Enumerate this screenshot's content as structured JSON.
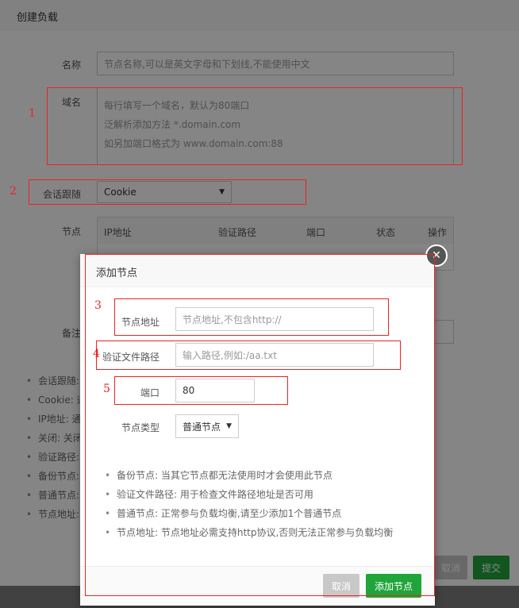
{
  "outer": {
    "title": "创建负载",
    "name_label": "名称",
    "name_placeholder": "节点名称,可以是英文字母和下划线,不能使用中文",
    "domain_label": "域名",
    "domain_lines": [
      "每行填写一个域名，默认为80端口",
      "泛解析添加方法 *.domain.com",
      "如另加端口格式为 www.domain.com:88"
    ],
    "session_label": "会话跟随",
    "session_value": "Cookie",
    "nodes_label": "节点",
    "nodes_columns": [
      "IP地址",
      "验证路径",
      "端口",
      "状态",
      "操作"
    ],
    "remark_label": "备注",
    "tips": [
      "会话跟随:",
      "Cookie: 通",
      "IP地址: 通",
      "关闭: 关闭",
      "验证路径:",
      "备份节点:",
      "普通节点:",
      "节点地址:"
    ],
    "cancel_label": "取消",
    "submit_label": "提交"
  },
  "inner": {
    "title": "添加节点",
    "address_label": "节点地址",
    "address_placeholder": "节点地址,不包含http://",
    "verify_label": "验证文件路径",
    "verify_placeholder": "输入路径,例如:/aa.txt",
    "port_label": "端口",
    "port_value": "80",
    "type_label": "节点类型",
    "type_value": "普通节点",
    "tips": [
      "备份节点: 当其它节点都无法使用时才会使用此节点",
      "验证文件路径: 用于检查文件路径地址是否可用",
      "普通节点: 正常参与负载均衡,请至少添加1个普通节点",
      "节点地址: 节点地址必需支持http协议,否则无法正常参与负载均衡"
    ],
    "cancel_label": "取消",
    "add_label": "添加节点"
  },
  "annotations": [
    "1",
    "2",
    "3",
    "4",
    "5"
  ],
  "colors": {
    "accent_green": "#20a53a",
    "annotation_red": "#e22222"
  },
  "icons": {
    "close": "close-icon",
    "select_caret": "caret-down-icon"
  }
}
